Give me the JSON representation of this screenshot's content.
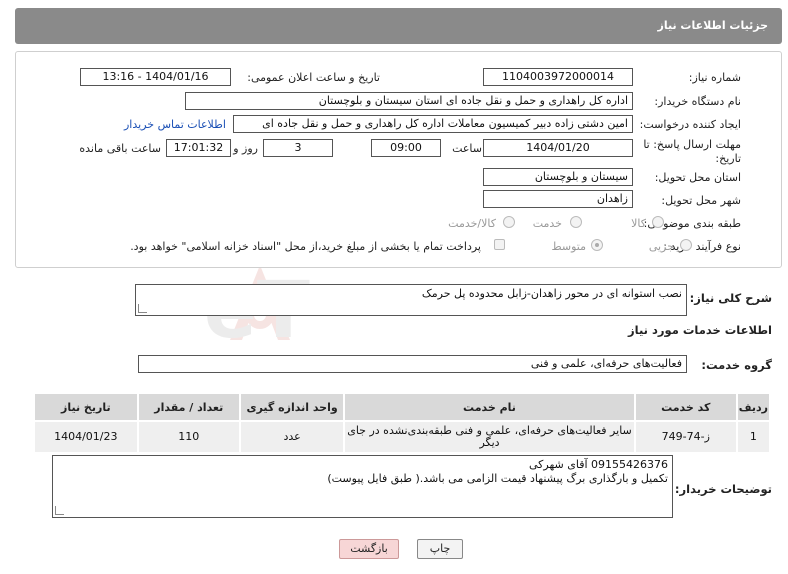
{
  "header": {
    "title": "جزئیات اطلاعات نیاز"
  },
  "fields": {
    "need_number_label": "شماره نیاز:",
    "need_number": "1104003972000014",
    "announce_label": "تاریخ و ساعت اعلان عمومی:",
    "announce_value": "1404/01/16 - 13:16",
    "buyer_label": "نام دستگاه خریدار:",
    "buyer_value": "اداره کل راهداری و حمل و نقل جاده ای استان سیستان و بلوچستان",
    "creator_label": "ایجاد کننده درخواست:",
    "creator_value": "امین دشتی زاده دبیر کمیسیون معاملات اداره کل راهداری و حمل و نقل جاده ای",
    "contact_link": "اطلاعات تماس خریدار",
    "deadline_label_1": "مهلت ارسال پاسخ: تا",
    "deadline_label_2": "تاریخ:",
    "deadline_date": "1404/01/20",
    "time_label": "ساعت",
    "deadline_time": "09:00",
    "days_value": "3",
    "days_label": "روز و",
    "remaining_time": "17:01:32",
    "remaining_label": "ساعت باقی مانده",
    "province_label": "استان محل تحویل:",
    "province_value": "سیستان و بلوچستان",
    "city_label": "شهر محل تحویل:",
    "city_value": "زاهدان",
    "category_label": "طبقه بندی موضوعی:",
    "category_options": [
      "کالا",
      "خدمت",
      "کالا/خدمت"
    ],
    "process_label": "نوع فرآیند خرید :",
    "process_options": [
      "جزیی",
      "متوسط"
    ],
    "payment_note": "پرداخت تمام یا بخشی از مبلغ خرید،از محل \"اسناد خزانه اسلامی\" خواهد بود."
  },
  "summary": {
    "label": "شرح کلی نیاز:",
    "value": "نصب استوانه ای در محور زاهدان-زابل محدوده پل حرمک"
  },
  "services": {
    "title": "اطلاعات خدمات مورد نیاز",
    "group_label": "گروه خدمت:",
    "group_value": "فعالیت‌های حرفه‌ای، علمی و فنی",
    "columns": [
      "ردیف",
      "کد خدمت",
      "نام خدمت",
      "واحد اندازه گیری",
      "تعداد / مقدار",
      "تاریخ نیاز"
    ],
    "rows": [
      {
        "index": "1",
        "code": "ز-74-749",
        "name_line1": "سایر فعالیت‌های حرفه‌ای، علمی و فنی طبقه‌بندی‌نشده در جای",
        "name_line2": "دیگر",
        "unit": "عدد",
        "qty": "110",
        "date": "1404/01/23"
      }
    ]
  },
  "buyer_notes": {
    "label": "توضیحات خریدار:",
    "line1": "09155426376 آقای شهرکی",
    "line2": "تکمیل و بارگذاری برگ پیشنهاد قیمت الزامی می باشد.( طبق فایل پیوست)"
  },
  "buttons": {
    "print": "چاپ",
    "back": "بازگشت"
  },
  "watermark": {
    "text": "AriaTender.neT"
  }
}
